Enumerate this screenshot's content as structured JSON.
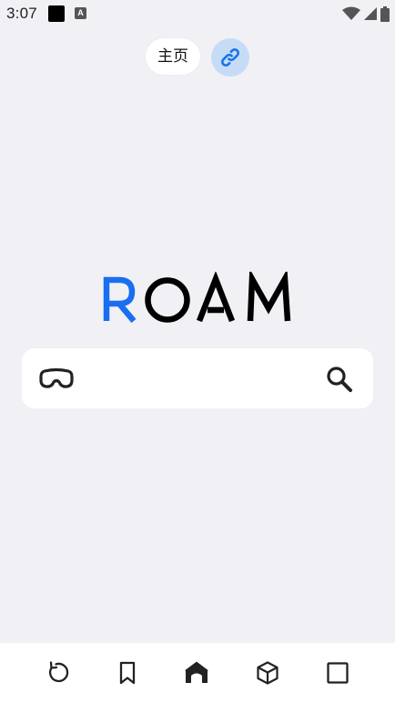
{
  "status_bar": {
    "time": "3:07",
    "notification_icons": [
      "black-square-icon",
      "text-a-icon"
    ],
    "notification_a_glyph": "A",
    "system_icons": [
      "wifi-icon",
      "cellular-signal-icon",
      "battery-icon"
    ]
  },
  "header": {
    "home_tab_label": "主页",
    "link_button_icon": "link-icon",
    "link_button_color": "#1a73e8",
    "link_button_bg": "#c6dcf6"
  },
  "logo": {
    "letters": [
      "R",
      "O",
      "A",
      "M"
    ],
    "accent_color": "#1a6ef0",
    "text_color": "#000000"
  },
  "search": {
    "left_icon": "vr-headset-icon",
    "value": "",
    "placeholder": "",
    "right_icon": "search-icon"
  },
  "bottom_nav": {
    "items": [
      {
        "icon": "refresh-icon"
      },
      {
        "icon": "bookmark-icon"
      },
      {
        "icon": "home-icon"
      },
      {
        "icon": "cube-icon"
      },
      {
        "icon": "square-tabs-icon"
      }
    ]
  }
}
